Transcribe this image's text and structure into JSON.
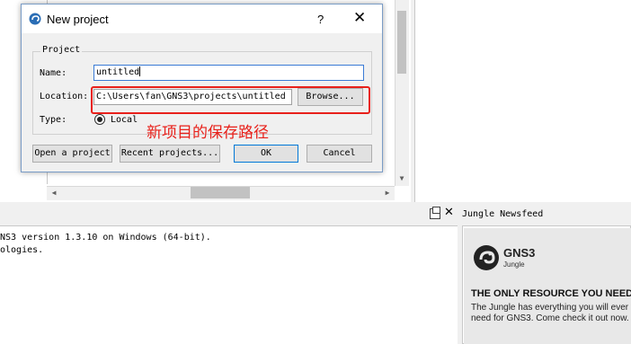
{
  "dialog": {
    "title": "New project",
    "help_label": "?",
    "close_label": "✕",
    "group_label": "Project",
    "name_label": "Name:",
    "name_value": "untitled",
    "location_label": "Location:",
    "location_value": "C:\\Users\\fan\\GNS3\\projects\\untitled",
    "browse_label": "Browse...",
    "type_label": "Type:",
    "type_value": "Local",
    "buttons": {
      "open": "Open a project",
      "recent": "Recent projects...",
      "ok": "OK",
      "cancel": "Cancel"
    }
  },
  "annotation": {
    "text": "新项目的保存路径",
    "color": "#e8201a"
  },
  "console": {
    "lines": [
      "NS3 version 1.3.10 on Windows (64-bit).",
      "ologies."
    ]
  },
  "newsfeed": {
    "title": "Jungle Newsfeed",
    "brand": "GNS3",
    "brand_sub": "Jungle",
    "headline": "THE ONLY RESOURCE YOU NEED",
    "body": "The Jungle has everything you will ever need for GNS3. Come check it out now."
  },
  "icons": [
    "gns3-app-icon",
    "help-icon",
    "close-icon",
    "restore-icon",
    "radio-selected-icon",
    "gns3-logo-icon"
  ]
}
